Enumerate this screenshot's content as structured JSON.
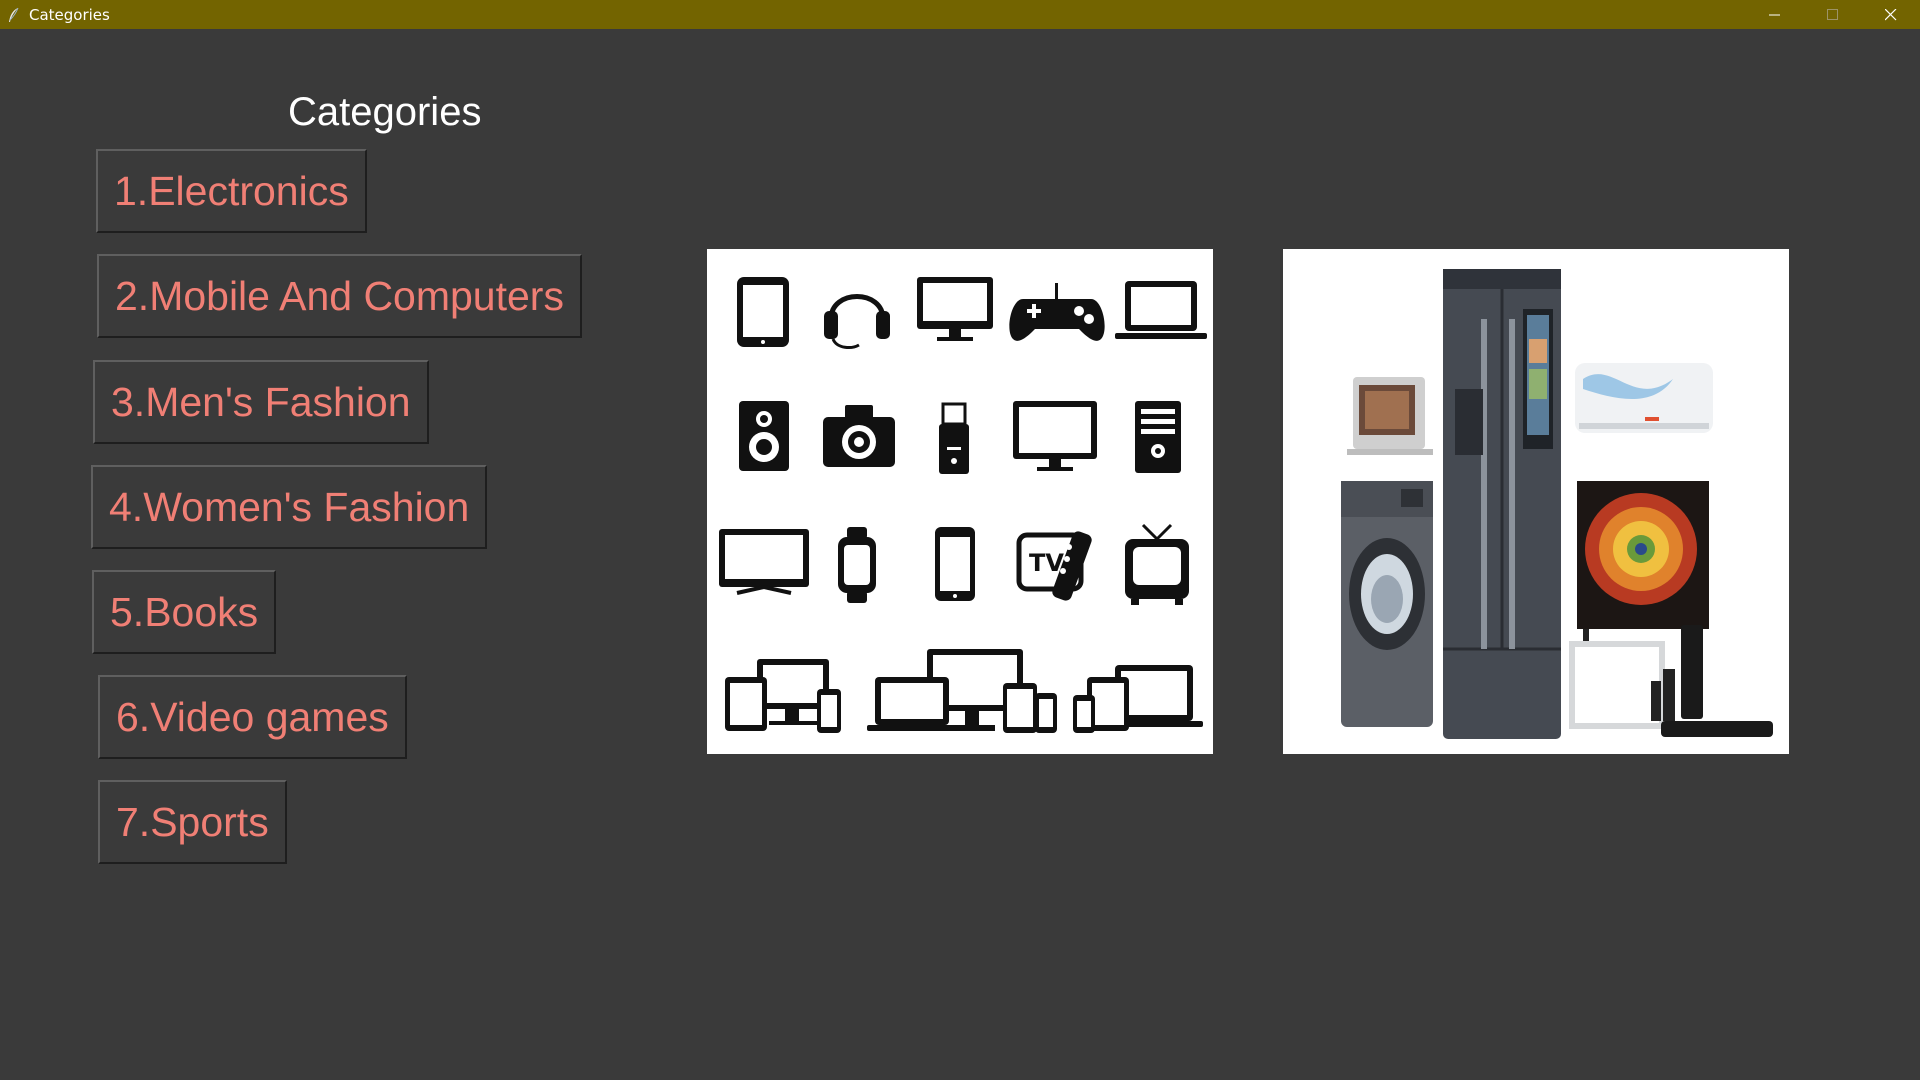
{
  "window": {
    "title": "Categories",
    "titlebar_color": "#736400",
    "icons": [
      "feather-app-icon",
      "minimize-icon",
      "maximize-icon",
      "close-icon"
    ]
  },
  "page": {
    "heading": "Categories",
    "background": "#3a3a3a",
    "button_text_color": "#f07f75"
  },
  "categories": [
    {
      "label": "1.Electronics"
    },
    {
      "label": "2.Mobile And Computers"
    },
    {
      "label": "3.Men's Fashion"
    },
    {
      "label": "4.Women's Fashion"
    },
    {
      "label": "5.Books"
    },
    {
      "label": "6.Video games"
    },
    {
      "label": "7.Sports"
    }
  ],
  "images": {
    "left": {
      "icons": [
        "tablet-icon",
        "headset-icon",
        "monitor-icon",
        "gamepad-icon",
        "laptop-icon",
        "speaker-icon",
        "camera-icon",
        "usb-drive-icon",
        "tv-icon",
        "computer-tower-icon",
        "widescreen-tv-icon",
        "smartwatch-icon",
        "smartphone-icon",
        "tv-remote-icon",
        "retro-tv-icon",
        "devices-icon",
        "devices-icon",
        "devices-icon"
      ],
      "tv_label": "TV"
    },
    "right": {
      "items": [
        "oven-icon",
        "washing-machine-icon",
        "refrigerator-icon",
        "air-conditioner-icon",
        "television-icon",
        "soundbar-icon"
      ]
    }
  }
}
